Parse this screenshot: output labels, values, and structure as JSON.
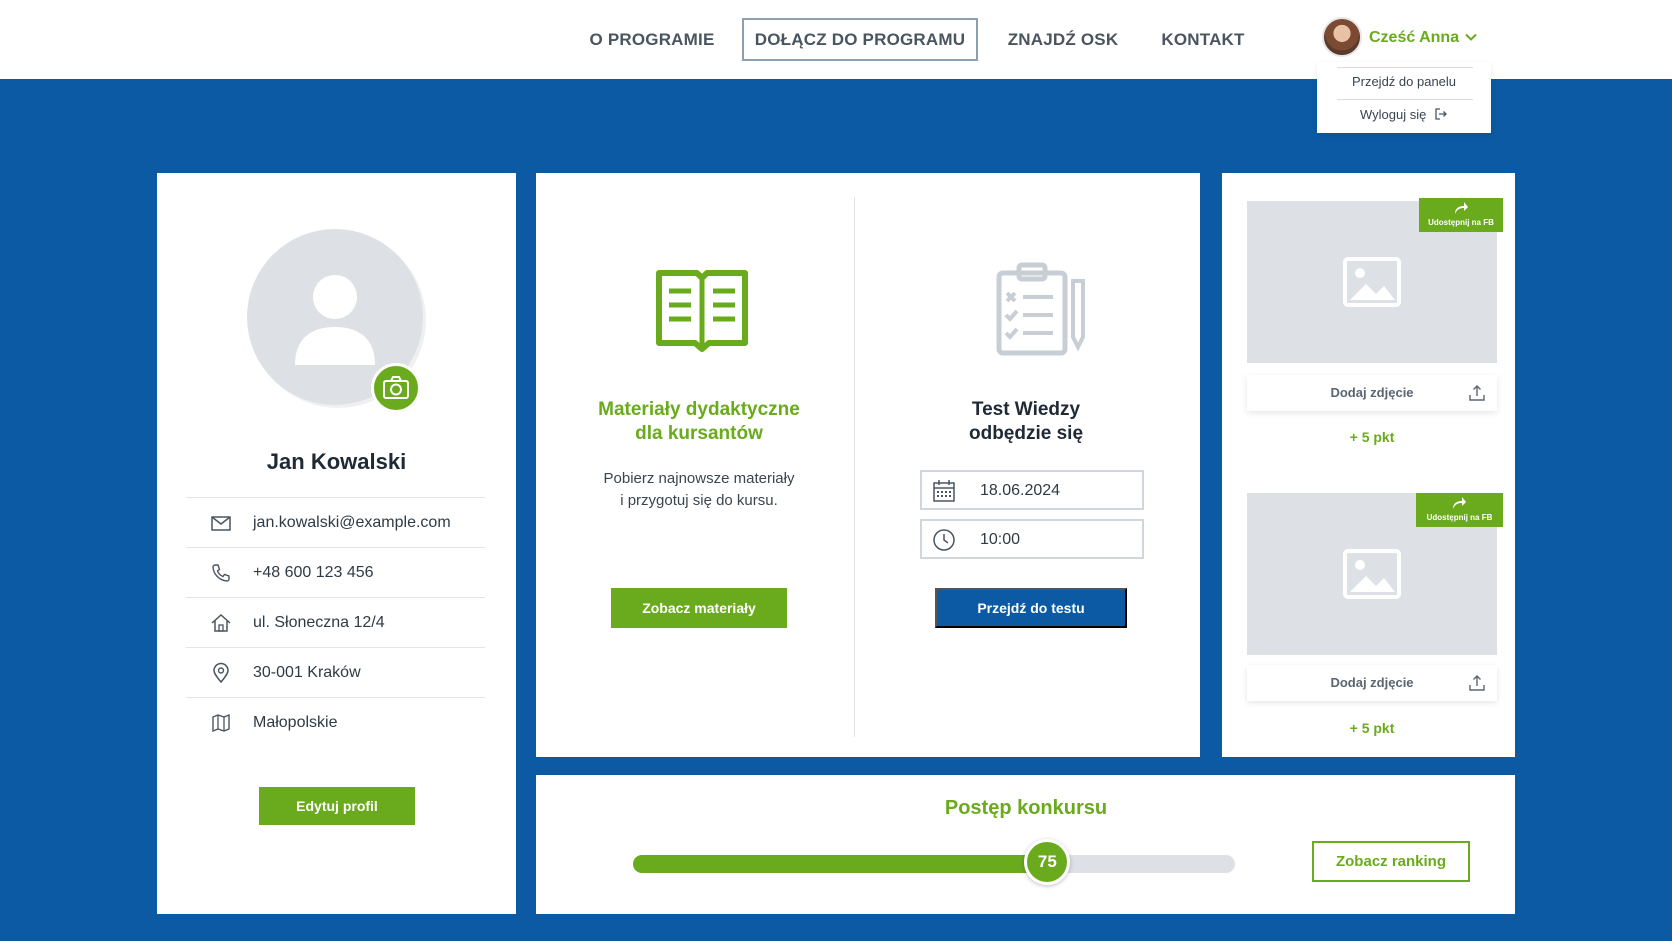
{
  "nav": {
    "items": [
      {
        "label": "O PROGRAMIE"
      },
      {
        "label": "DOŁĄCZ DO PROGRAMU"
      },
      {
        "label": "ZNAJDŹ OSK"
      },
      {
        "label": "KONTAKT"
      }
    ],
    "active_index": 1
  },
  "user": {
    "greeting": "Cześć Anna",
    "menu": {
      "dashboard": "Przejdź do panelu",
      "logout": "Wyloguj się"
    }
  },
  "profile": {
    "name": "Jan Kowalski",
    "details": [
      {
        "icon": "envelope-icon",
        "value": "jan.kowalski@example.com"
      },
      {
        "icon": "phone-icon",
        "value": "+48 600 123 456"
      },
      {
        "icon": "home-icon",
        "value": "ul. Słoneczna 12/4"
      },
      {
        "icon": "location-pin-icon",
        "value": "30-001 Kraków"
      },
      {
        "icon": "map-icon",
        "value": "Małopolskie"
      }
    ],
    "edit_label": "Edytuj profil"
  },
  "materials": {
    "title_line1": "Materiały dydaktyczne",
    "title_line2": "dla kursantów",
    "desc_line1": "Pobierz najnowsze materiały",
    "desc_line2": "i przygotuj się do kursu.",
    "button": "Zobacz materiały"
  },
  "test": {
    "title_line1": "Test Wiedzy",
    "title_line2": "odbędzie się",
    "date": "18.06.2024",
    "time": "10:00",
    "button": "Przejdź do testu"
  },
  "photos": [
    {
      "fb_label": "Udostępnij na FB",
      "add_label": "Dodaj zdjęcie",
      "points": "+ 5 pkt"
    },
    {
      "fb_label": "Udostępnij na FB",
      "add_label": "Dodaj zdjęcie",
      "points": "+ 5 pkt"
    }
  ],
  "progress": {
    "title": "Postęp konkursu",
    "value": 75,
    "value_label": "75",
    "ranking_button": "Zobacz ranking"
  },
  "colors": {
    "brand_blue": "#0b5aa3",
    "brand_green": "#6aab1e"
  }
}
